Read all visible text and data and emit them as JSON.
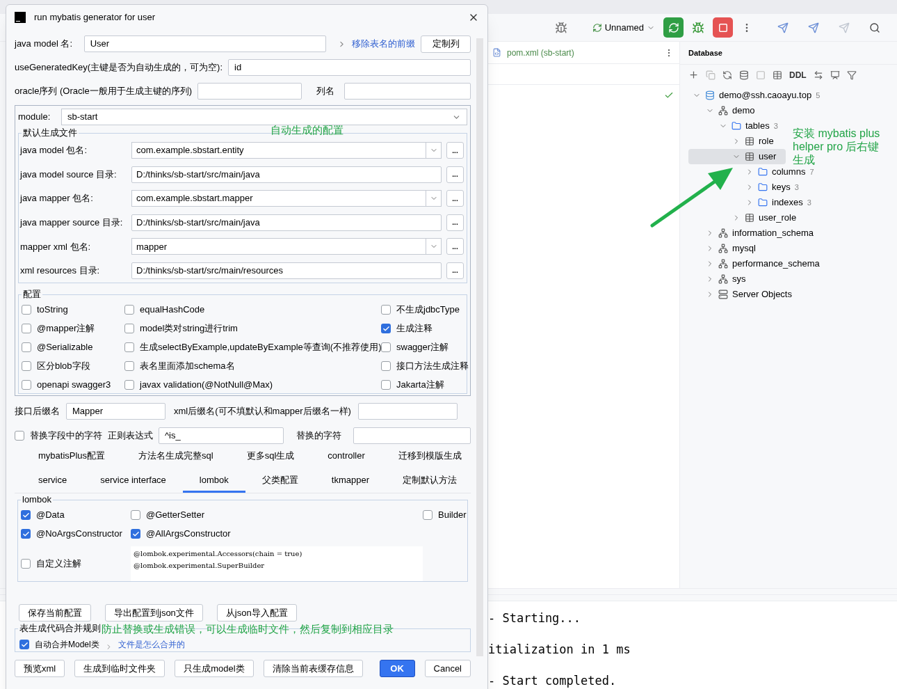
{
  "ide": {
    "toolbar": {
      "run_config": "Unnamed"
    },
    "editor_tab": {
      "label": "pom.xml (sb-start)"
    },
    "database": {
      "title": "Database",
      "toolbar_label": "DDL",
      "tree": [
        {
          "label": "demo@ssh.caoayu.top",
          "kind": "connection",
          "count": "5",
          "expanded": true,
          "selected": false,
          "children": [
            {
              "label": "demo",
              "kind": "schema",
              "expanded": true,
              "selected": false,
              "children": [
                {
                  "label": "tables",
                  "kind": "folder",
                  "count": "3",
                  "expanded": true,
                  "selected": false,
                  "children": [
                    {
                      "label": "role",
                      "kind": "table",
                      "expanded": false,
                      "selected": false
                    },
                    {
                      "label": "user",
                      "kind": "table",
                      "expanded": true,
                      "selected": true,
                      "children": [
                        {
                          "label": "columns",
                          "kind": "folder",
                          "count": "7",
                          "expanded": false,
                          "selected": false
                        },
                        {
                          "label": "keys",
                          "kind": "folder",
                          "count": "3",
                          "expanded": false,
                          "selected": false
                        },
                        {
                          "label": "indexes",
                          "kind": "folder",
                          "count": "3",
                          "expanded": false,
                          "selected": false
                        }
                      ]
                    },
                    {
                      "label": "user_role",
                      "kind": "table",
                      "expanded": false,
                      "selected": false
                    }
                  ]
                }
              ]
            },
            {
              "label": "information_schema",
              "kind": "schema",
              "expanded": false,
              "selected": false
            },
            {
              "label": "mysql",
              "kind": "schema",
              "expanded": false,
              "selected": false
            },
            {
              "label": "performance_schema",
              "kind": "schema",
              "expanded": false,
              "selected": false
            },
            {
              "label": "sys",
              "kind": "schema",
              "expanded": false,
              "selected": false
            },
            {
              "label": "Server Objects",
              "kind": "server",
              "expanded": false,
              "selected": false
            }
          ]
        }
      ]
    },
    "annotation": "安装 mybatis plus helper pro 后右键生成",
    "console": [
      "- Starting...",
      "itialization in 1 ms",
      "- Start completed."
    ]
  },
  "dialog": {
    "title": "run mybatis generator for user",
    "model_name": {
      "label": "java model 名:",
      "value": "User"
    },
    "remove_prefix_link": "移除表名的前缀",
    "custom_columns_button": "定制列",
    "generated_key": {
      "label": "useGeneratedKey(主键是否为自动生成的，可为空):",
      "value": "id"
    },
    "oracle_sequence": {
      "label": "oracle序列 (Oracle一般用于生成主键的序列)"
    },
    "column_name": {
      "label": "列名"
    },
    "module": {
      "label": "module:",
      "value": "sb-start"
    },
    "default_files": {
      "legend": "默认生成文件",
      "rows": [
        {
          "label": "java model 包名:",
          "value": "com.example.sbstart.entity",
          "kind": "combo",
          "button": "..."
        },
        {
          "label": "java model source 目录:",
          "value": "D:/thinks/sb-start/src/main/java",
          "kind": "text",
          "button": "..."
        },
        {
          "label": "java mapper 包名:",
          "value": "com.example.sbstart.mapper",
          "kind": "combo",
          "button": "..."
        },
        {
          "label": "java mapper source 目录:",
          "value": "D:/thinks/sb-start/src/main/java",
          "kind": "text",
          "button": "..."
        },
        {
          "label": "mapper xml 包名:",
          "value": "mapper",
          "kind": "combo",
          "button": "..."
        },
        {
          "label": "xml resources 目录:",
          "value": "D:/thinks/sb-start/src/main/resources",
          "kind": "text",
          "button": "..."
        }
      ]
    },
    "auto_note": "自动生成的配置",
    "options": {
      "legend": "配置",
      "items": [
        {
          "label": "toString",
          "checked": false
        },
        {
          "label": "equalHashCode",
          "checked": false
        },
        {
          "label": "不生成jdbcType",
          "checked": false
        },
        {
          "label": "@mapper注解",
          "checked": false
        },
        {
          "label": "model类对string进行trim",
          "checked": false
        },
        {
          "label": "生成注释",
          "checked": true
        },
        {
          "label": "@Serializable",
          "checked": false
        },
        {
          "label": "生成selectByExample,updateByExample等查询(不推荐使用)",
          "checked": false
        },
        {
          "label": "swagger注解",
          "checked": false
        },
        {
          "label": "区分blob字段",
          "checked": false
        },
        {
          "label": "表名里面添加schema名",
          "checked": false
        },
        {
          "label": "接口方法生成注释",
          "checked": false
        },
        {
          "label": "openapi swagger3",
          "checked": false
        },
        {
          "label": "javax validation(@NotNull@Max)",
          "checked": false
        },
        {
          "label": "Jakarta注解",
          "checked": false
        }
      ]
    },
    "interface_suffix": {
      "label": "接口后缀名",
      "value": "Mapper"
    },
    "xml_suffix": {
      "label": "xml后缀名(可不填默认和mapper后缀名一样)"
    },
    "replace": {
      "label": "替换字段中的字符",
      "checked": false,
      "regex_label": "正则表达式",
      "regex_value": "^is_",
      "replacement_label": "替换的字符"
    },
    "tab_rows": [
      {
        "tabs": [
          {
            "label": "mybatisPlus配置",
            "selected": false
          },
          {
            "label": "方法名生成完整sql",
            "selected": false
          },
          {
            "label": "更多sql生成",
            "selected": false
          },
          {
            "label": "controller",
            "selected": false
          },
          {
            "label": "迁移到模版生成",
            "selected": false
          }
        ]
      },
      {
        "tabs": [
          {
            "label": "service",
            "selected": false
          },
          {
            "label": "service interface",
            "selected": false
          },
          {
            "label": "lombok",
            "selected": true
          },
          {
            "label": "父类配置",
            "selected": false
          },
          {
            "label": "tkmapper",
            "selected": false
          },
          {
            "label": "定制默认方法",
            "selected": false
          }
        ]
      }
    ],
    "lombok": {
      "legend": "lombok",
      "options": [
        {
          "label": "@Data",
          "checked": true
        },
        {
          "label": "@GetterSetter",
          "checked": false
        },
        {
          "label": "Builder",
          "checked": false
        },
        {
          "label": "@NoArgsConstructor",
          "checked": true
        },
        {
          "label": "@AllArgsConstructor",
          "checked": true
        }
      ],
      "custom": {
        "label": "自定义注解",
        "checked": false,
        "lines": [
          "@lombok.experimental.Accessors(chain = true)",
          "@lombok.experimental.SuperBuilder"
        ]
      }
    },
    "config_buttons": [
      "保存当前配置",
      "导出配置到json文件",
      "从json导入配置"
    ],
    "merge": {
      "legend": "表生成代码合并规则",
      "option": {
        "label": "自动合并Model类",
        "checked": true
      },
      "link": "文件是怎么合并的"
    },
    "temp_note": "防止替换或生成错误，可以生成临时文件，然后复制到相应目录",
    "footer_buttons": [
      {
        "label": "预览xml",
        "primary": false
      },
      {
        "label": "生成到临时文件夹",
        "primary": false
      },
      {
        "label": "只生成model类",
        "primary": false
      },
      {
        "label": "清除当前表缓存信息",
        "primary": false
      },
      {
        "label": "OK",
        "primary": true
      },
      {
        "label": "Cancel",
        "primary": false
      }
    ]
  }
}
